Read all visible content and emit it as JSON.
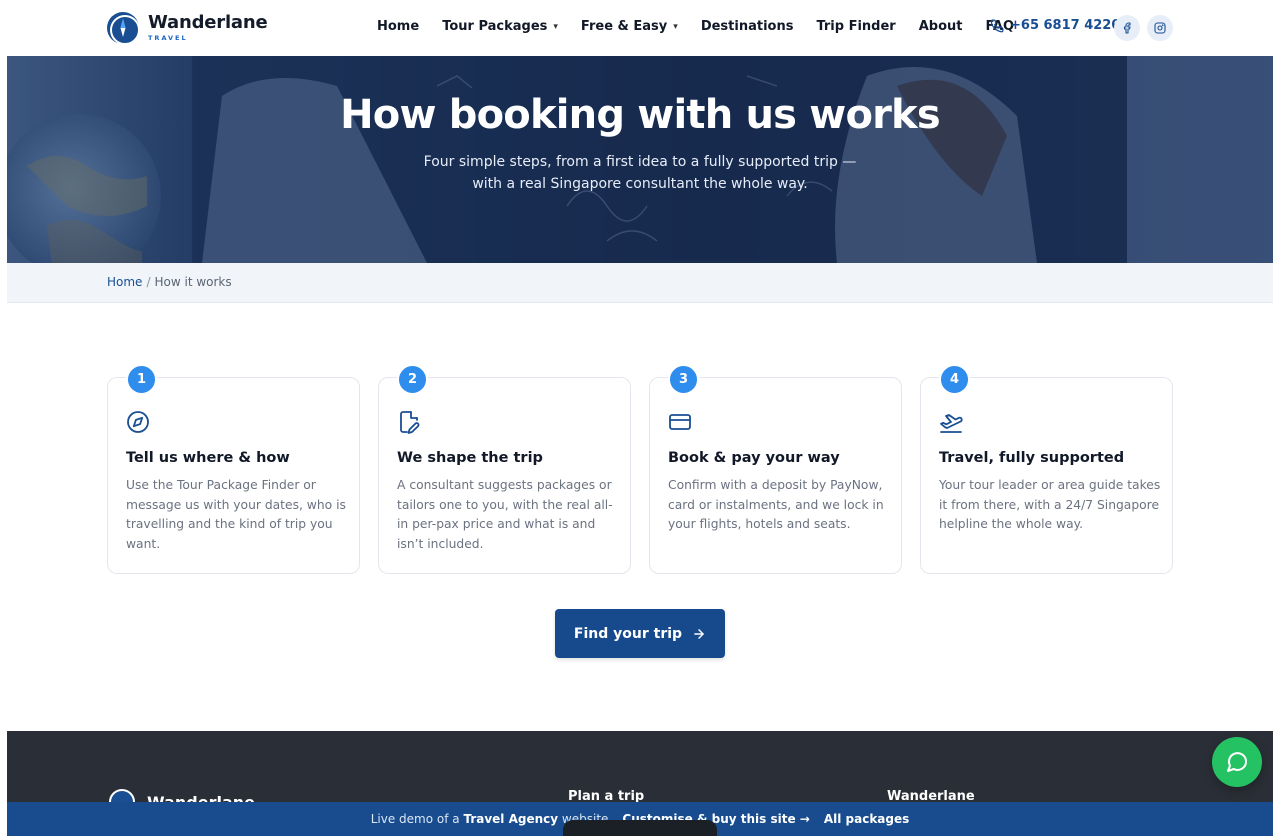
{
  "brand": {
    "name": "Wanderlane",
    "tagline": "TRAVEL"
  },
  "nav": {
    "items": [
      {
        "label": "Home",
        "dropdown": false
      },
      {
        "label": "Tour Packages",
        "dropdown": true
      },
      {
        "label": "Free & Easy",
        "dropdown": true
      },
      {
        "label": "Destinations",
        "dropdown": false
      },
      {
        "label": "Trip Finder",
        "dropdown": false
      },
      {
        "label": "About",
        "dropdown": false
      },
      {
        "label": "FAQ",
        "dropdown": false
      }
    ],
    "phone": "+65 6817 4220",
    "social": [
      "facebook-icon",
      "instagram-icon"
    ]
  },
  "hero": {
    "title": "How booking with us works",
    "subtitle": "Four simple steps, from a first idea to a fully supported trip — with a real Singapore consultant the whole way."
  },
  "breadcrumb": {
    "home": "Home",
    "separator": "/",
    "current": "How it works"
  },
  "steps": [
    {
      "number": "1",
      "icon": "compass-icon",
      "title": "Tell us where & how",
      "body": "Use the Tour Package Finder or message us with your dates, who is travelling and the kind of trip you want."
    },
    {
      "number": "2",
      "icon": "document-edit-icon",
      "title": "We shape the trip",
      "body": "A consultant suggests packages or tailors one to you, with the real all-in per-pax price and what is and isn’t included."
    },
    {
      "number": "3",
      "icon": "credit-card-icon",
      "title": "Book & pay your way",
      "body": "Confirm with a deposit by PayNow, card or instalments, and we lock in your flights, hotels and seats."
    },
    {
      "number": "4",
      "icon": "plane-departure-icon",
      "title": "Travel, fully supported",
      "body": "Your tour leader or area guide takes it from there, with a 24/7 Singapore helpline the whole way."
    }
  ],
  "cta": {
    "label": "Find your trip"
  },
  "footer": {
    "brand": "Wanderlane",
    "col2_title": "Plan a trip",
    "col3_title": "Wanderlane"
  },
  "demobar": {
    "prefix": "Live demo of a",
    "site_type": "Travel Agency",
    "suffix": "website",
    "buy_link": "Customise & buy this site →",
    "packages_link": "All packages"
  },
  "colors": {
    "primary": "#164a8c",
    "accent": "#2f8dee",
    "whatsapp": "#25c264",
    "footer": "#2a2e36"
  }
}
